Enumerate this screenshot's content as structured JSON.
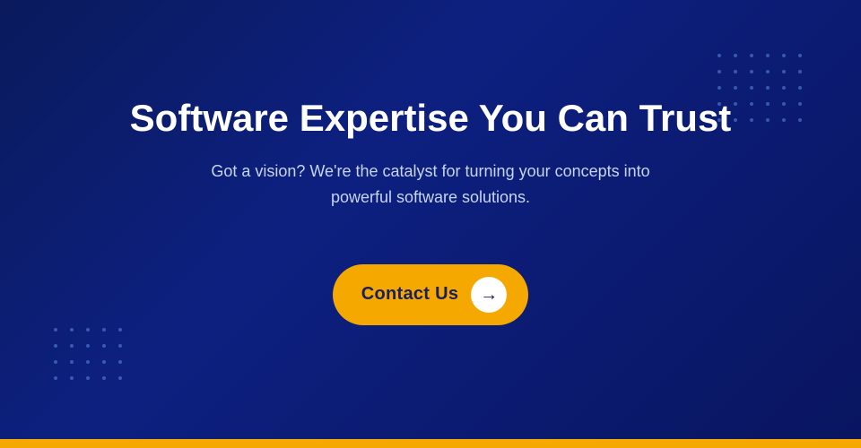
{
  "page": {
    "background_color": "#0a1a5c",
    "accent_color": "#f5a800",
    "text_color": "#ffffff",
    "subtitle_color": "#c8d4f0"
  },
  "hero": {
    "title": "Software Expertise You Can Trust",
    "subtitle_line1": "Got a vision? We're the catalyst for turning your concepts into",
    "subtitle_line2": "powerful software solutions.",
    "subtitle": "Got a vision? We're the catalyst for turning your concepts into powerful software solutions."
  },
  "cta": {
    "label": "Contact Us",
    "arrow": "→"
  },
  "decorations": {
    "dots_count": 30
  }
}
